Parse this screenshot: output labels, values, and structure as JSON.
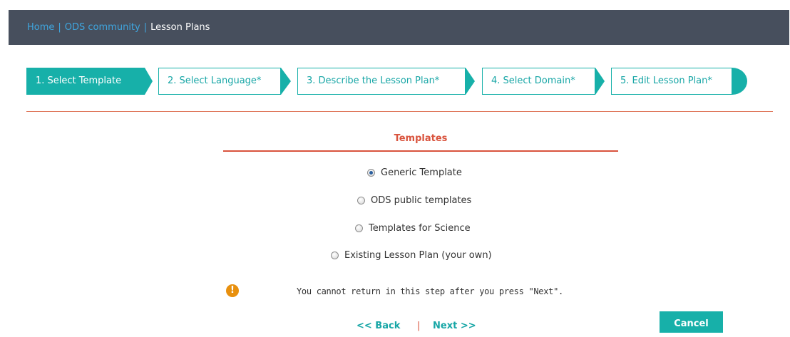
{
  "breadcrumb": {
    "home": "Home",
    "community": "ODS community",
    "current": "Lesson Plans",
    "separator": "|"
  },
  "steps": [
    {
      "label": "1. Select Template",
      "active": true
    },
    {
      "label": "2. Select Language*",
      "active": false
    },
    {
      "label": "3. Describe the Lesson Plan*",
      "active": false
    },
    {
      "label": "4. Select Domain*",
      "active": false
    },
    {
      "label": "5. Edit Lesson Plan*",
      "active": false
    }
  ],
  "section_title": "Templates",
  "options": [
    {
      "label": "Generic Template",
      "selected": true
    },
    {
      "label": "ODS public templates",
      "selected": false
    },
    {
      "label": "Templates for Science",
      "selected": false
    },
    {
      "label": "Existing Lesson Plan (your own)",
      "selected": false
    }
  ],
  "warning": {
    "icon": "exclamation-icon",
    "glyph": "!",
    "text": "You cannot return in this step after you press \"Next\"."
  },
  "nav": {
    "back": "<< Back",
    "separator": "|",
    "next": "Next >>"
  },
  "cancel_label": "Cancel",
  "colors": {
    "accent": "#17b0a9",
    "header_bg": "#474f5d",
    "link": "#3fa6df",
    "section_red": "#d9533d",
    "warning": "#e8900e"
  }
}
